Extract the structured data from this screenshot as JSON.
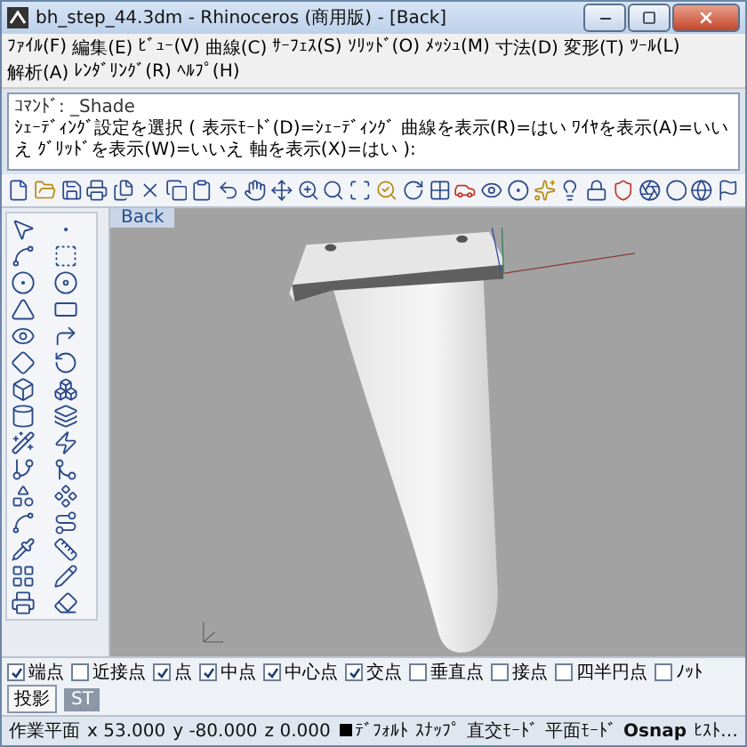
{
  "window": {
    "title": "bh_step_44.3dm - Rhinoceros (商用版) - [Back]"
  },
  "menu": [
    "ﾌｧｲﾙ(F)",
    "編集(E)",
    "ﾋﾞｭｰ(V)",
    "曲線(C)",
    "ｻｰﾌｪｽ(S)",
    "ｿﾘｯﾄﾞ(O)",
    "ﾒｯｼｭ(M)",
    "寸法(D)",
    "変形(T)",
    "ﾂｰﾙ(L)",
    "解析(A)",
    "ﾚﾝﾀﾞﾘﾝｸﾞ(R)",
    "ﾍﾙﾌﾟ(H)"
  ],
  "command": {
    "history": "ｺﾏﾝﾄﾞ: _Shade",
    "prompt": "ｼｪｰﾃﾞｨﾝｸﾞ設定を選択 ( 表示ﾓｰﾄﾞ(D)=ｼｪｰﾃﾞｨﾝｸﾞ 曲線を表示(R)=はい ﾜｲﾔを表示(A)=いいえ ｸﾞﾘｯﾄﾞを表示(W)=いいえ 軸を表示(X)=はい ):"
  },
  "viewport": {
    "label": "Back"
  },
  "osnap": [
    {
      "label": "端点",
      "kind": "check",
      "checked": true
    },
    {
      "label": "近接点",
      "kind": "check",
      "checked": false
    },
    {
      "label": "点",
      "kind": "check",
      "checked": true
    },
    {
      "label": "中点",
      "kind": "check",
      "checked": true
    },
    {
      "label": "中心点",
      "kind": "check",
      "checked": true
    },
    {
      "label": "交点",
      "kind": "check",
      "checked": true
    },
    {
      "label": "垂直点",
      "kind": "check",
      "checked": false
    },
    {
      "label": "接点",
      "kind": "check",
      "checked": false
    },
    {
      "label": "四半円点",
      "kind": "check",
      "checked": false
    },
    {
      "label": "ﾉｯﾄ",
      "kind": "check",
      "checked": false
    },
    {
      "label": "投影",
      "kind": "toggle",
      "checked": false
    },
    {
      "label": "ST",
      "kind": "toggle",
      "checked": true
    }
  ],
  "status_bar": [
    {
      "text": "作業平面",
      "kind": "label"
    },
    {
      "text": "x 53.000",
      "kind": "coord"
    },
    {
      "text": "y -80.000",
      "kind": "coord"
    },
    {
      "text": "z 0.000",
      "kind": "coord"
    },
    {
      "text": "ﾃﾞﾌｫﾙﾄ",
      "kind": "layer",
      "color": "#000000"
    },
    {
      "text": "ｽﾅｯﾌﾟ",
      "kind": "pane",
      "active": false
    },
    {
      "text": "直交ﾓｰﾄﾞ",
      "kind": "pane",
      "active": false
    },
    {
      "text": "平面ﾓｰﾄﾞ",
      "kind": "pane",
      "active": false
    },
    {
      "text": "Osnap",
      "kind": "pane",
      "active": true
    },
    {
      "text": "ﾋｽﾄ…",
      "kind": "pane",
      "active": false
    }
  ]
}
